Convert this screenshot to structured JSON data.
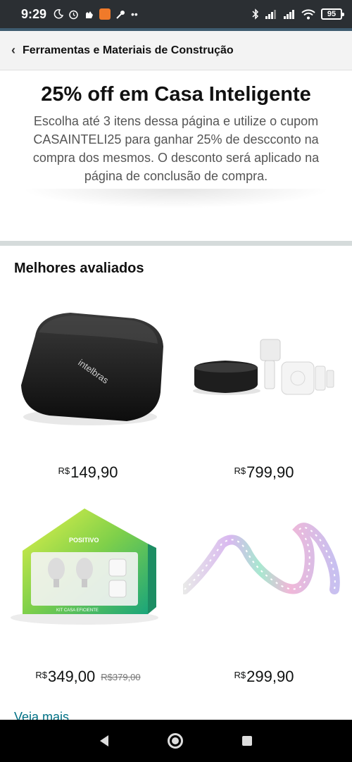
{
  "status_bar": {
    "time": "9:29",
    "left_icons": [
      "moon-icon",
      "alarm-icon",
      "hand-icon",
      "app-badge-icon",
      "key-icon",
      "more-dots-icon"
    ],
    "more_dots": "••",
    "right_icons": [
      "bluetooth-icon",
      "signal-icon",
      "signal-icon",
      "wifi-icon",
      "battery-icon"
    ],
    "battery_level": "95"
  },
  "header": {
    "title": "Ferramentas e Materiais de Construção"
  },
  "promo": {
    "title": "25% off em Casa Inteligente",
    "text": "Escolha até 3 itens dessa página e utilize o cupom CASAINTELI25 para ganhar 25% de descconto na compra dos mesmos. O desconto será aplicado na página de conclusão de compra."
  },
  "section": {
    "title": "Melhores avaliados"
  },
  "products": [
    {
      "currency": "R$",
      "price": "149,90",
      "image_text": "intelbras"
    },
    {
      "currency": "R$",
      "price": "799,90"
    },
    {
      "currency": "R$",
      "price": "349,00",
      "old_price": "R$379,00",
      "image_text": "POSITIVO",
      "image_subtext": "KIT CASA EFICIENTE"
    },
    {
      "currency": "R$",
      "price": "299,90"
    }
  ],
  "see_more": "Veja mais",
  "colors": {
    "status_bar": "#2b2f33",
    "link": "#007185",
    "divider": "#d5dbdb"
  }
}
